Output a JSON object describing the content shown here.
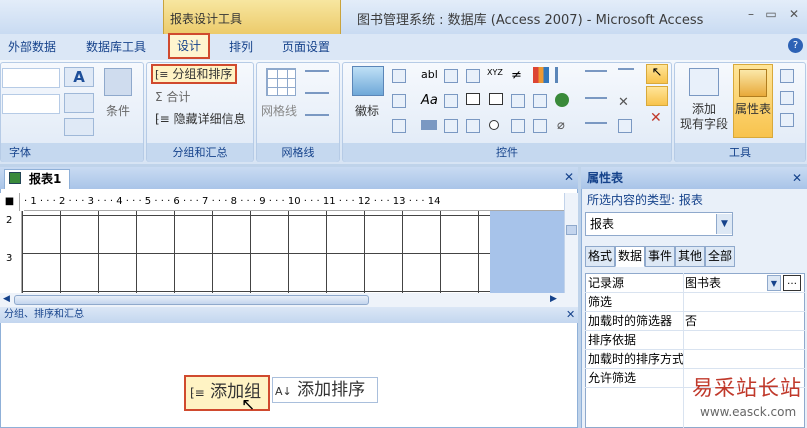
{
  "titlebar": {
    "context_label": "报表设计工具",
    "title": "图书管理系统 : 数据库 (Access 2007) - Microsoft Access",
    "min": "–",
    "max": "▭",
    "close": "✕"
  },
  "tabs": [
    "外部数据",
    "数据库工具",
    "设计",
    "排列",
    "页面设置"
  ],
  "help": "?",
  "ribbon": {
    "font_group": {
      "label": "字体",
      "font_btn": "A",
      "cond_label": "条件"
    },
    "grouping_group": {
      "label": "分组和汇总",
      "group_sort": "分组和排序",
      "totals": "合计",
      "hide_details": "隐藏详细信息"
    },
    "gridlines_group": {
      "label": "网格线",
      "gridlines": "网格线"
    },
    "controls_group": {
      "label": "控件",
      "logo": "徽标",
      "abl": "abl",
      "aa": "Aa",
      "xyz": "XYZ"
    },
    "tools_group": {
      "label": "工具",
      "add_fields": "添加\n现有字段",
      "add_line1": "添加",
      "add_line2": "现有字段",
      "property_sheet": "属性表"
    }
  },
  "document": {
    "tab_label": "报表1",
    "ruler": "· 1 · · · 2 · · · 3 · · · 4 · · · 5 · · · 6 · · · 7 · · · 8 · · · 9 · · · 10 · · · 11 · · · 12 · · · 13 · · · 14",
    "vruler": [
      "2",
      "3"
    ]
  },
  "group_pane": {
    "title": "分组、排序和汇总",
    "add_group": "添加组",
    "add_sort": "添加排序"
  },
  "property_sheet": {
    "title": "属性表",
    "selection_type_label": "所选内容的类型: 报表",
    "selected": "报表",
    "tabs": [
      "格式",
      "数据",
      "事件",
      "其他",
      "全部"
    ],
    "rows": [
      {
        "name": "记录源",
        "value": "图书表"
      },
      {
        "name": "筛选",
        "value": ""
      },
      {
        "name": "加载时的筛选器",
        "value": "否"
      },
      {
        "name": "排序依据",
        "value": ""
      },
      {
        "name": "加载时的排序方式",
        "value": ""
      },
      {
        "name": "允许筛选",
        "value": ""
      }
    ]
  },
  "watermark": {
    "text": "易采站长站",
    "url": "www.easck.com"
  },
  "colors": {
    "accent": "#d04a2e",
    "ribbon": "#dbe7f6",
    "text": "#15428b"
  }
}
